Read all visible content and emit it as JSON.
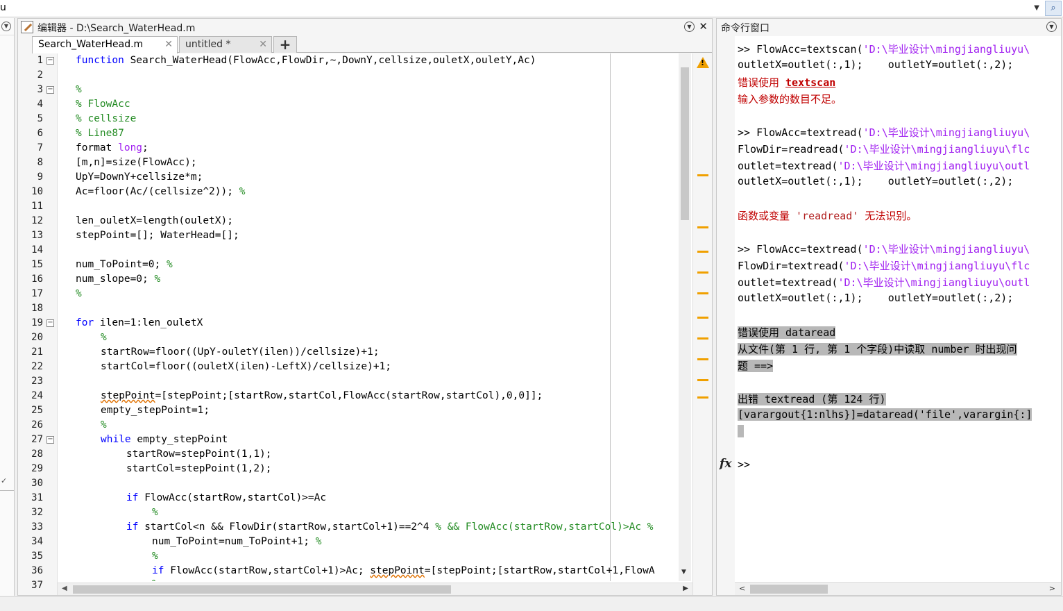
{
  "topbar": {
    "address_fragment": "u"
  },
  "editor": {
    "title_prefix": "编辑器 - ",
    "file_path": "D:\\Search_WaterHead.m",
    "tabs": [
      {
        "label": "Search_WaterHead.m"
      },
      {
        "label": "untitled *"
      }
    ],
    "add_tab_label": "+",
    "line_numbers": [
      "1",
      "2",
      "3",
      "4",
      "5",
      "6",
      "7",
      "8",
      "9",
      "10",
      "11",
      "12",
      "13",
      "14",
      "15",
      "16",
      "17",
      "18",
      "19",
      "20",
      "21",
      "22",
      "23",
      "24",
      "25",
      "26",
      "27",
      "28",
      "29",
      "30",
      "31",
      "32",
      "33",
      "34",
      "35",
      "36",
      "37"
    ],
    "fold_symbol": "−",
    "code": {
      "l1_kw": "function",
      "l1": " Search_WaterHead(FlowAcc,FlowDir,~,DownY,cellsize,ouletX,ouletY,Ac)",
      "l3": "%",
      "l4": "% FlowAcc",
      "l5": "% cellsize",
      "l6": "% Line87",
      "l7": "format ",
      "l7_kw": "long",
      "l7_end": ";",
      "l8": "[m,n]=size(FlowAcc);",
      "l9": "UpY=DownY+cellsize*m;",
      "l10": "Ac=floor(Ac/(cellsize^2)); ",
      "l10_c": "%",
      "l12": "len_ouletX=length(ouletX);",
      "l13": "stepPoint=[]; WaterHead=[];",
      "l15": "num_ToPoint=0; ",
      "l15_c": "%",
      "l16": "num_slope=0; ",
      "l16_c": "%",
      "l17": "%",
      "l19_kw": "for",
      "l19": " ilen=1:len_ouletX",
      "l20": "%",
      "l21": "startRow=floor((UpY-ouletY(ilen))/cellsize)+1;",
      "l22": "startCol=floor((ouletX(ilen)-LeftX)/cellsize)+1;",
      "l24_sq": "stepPoint",
      "l24": "=[stepPoint;[startRow,startCol,FlowAcc(startRow,startCol),0,0]];",
      "l25": "empty_stepPoint=1;",
      "l26": "%",
      "l27_kw": "while",
      "l27": " empty_stepPoint",
      "l28": "startRow=stepPoint(1,1);",
      "l29": "startCol=stepPoint(1,2);",
      "l31_kw": "if",
      "l31": " FlowAcc(startRow,startCol)>=Ac",
      "l32": "%",
      "l33_kw": "if",
      "l33": " startCol<n && FlowDir(startRow,startCol+1)==2^4 ",
      "l33_c": "% && FlowAcc(startRow,startCol)>Ac %",
      "l34": "num_ToPoint=num_ToPoint+1; ",
      "l34_c": "%",
      "l35": "%",
      "l36_kw": "if",
      "l36": " FlowAcc(startRow,startCol+1)>Ac; ",
      "l36_sq": "stepPoint",
      "l36_end": "=[stepPoint;[startRow,startCol+1,FlowA",
      "l37": "%"
    }
  },
  "command_window": {
    "title": "命令行窗口",
    "prompt": ">>",
    "lines": {
      "c1a": ">> FlowAcc=textscan(",
      "c1s": "'D:\\毕业设计\\mingjiangliuyu\\",
      "c2": "outletX=outlet(:,1);    outletY=outlet(:,2);",
      "c3a": "错误使用 ",
      "c3b": "textscan",
      "c4": "输入参数的数目不足。",
      "c6a": ">> FlowAcc=textread(",
      "c6s": "'D:\\毕业设计\\mingjiangliuyu\\",
      "c7a": "FlowDir=readread(",
      "c7s": "'D:\\毕业设计\\mingjiangliuyu\\flc",
      "c8a": "outlet=textread(",
      "c8s": "'D:\\毕业设计\\mingjiangliuyu\\outl",
      "c9": "outletX=outlet(:,1);    outletY=outlet(:,2);",
      "c11a": "函数或变量 ",
      "c11s": "'readread'",
      "c11b": " 无法识别。",
      "c13a": ">> FlowAcc=textread(",
      "c13s": "'D:\\毕业设计\\mingjiangliuyu\\",
      "c14a": "FlowDir=textread(",
      "c14s": "'D:\\毕业设计\\mingjiangliuyu\\flc",
      "c15a": "outlet=textread(",
      "c15s": "'D:\\毕业设计\\mingjiangliuyu\\outl",
      "c16": "outletX=outlet(:,1);    outletY=outlet(:,2);",
      "c18": "错误使用 dataread",
      "c19": "从文件(第 1 行, 第 1 个字段)中读取 number 时出现问",
      "c20": "题 ==>",
      "c22": "出错 textread (第 124 行)",
      "c23": "[varargout{1:nlhs}]=dataread('file',varargin{:]",
      "c24": " "
    }
  },
  "colors": {
    "keyword": "#0000ff",
    "comment": "#228b22",
    "string": "#a020f0",
    "error": "#c00000",
    "warning_marker": "#f0a000"
  },
  "icons": [
    "search-icon",
    "edit-pen-icon",
    "panel-menu-icon",
    "close-icon",
    "warning-icon",
    "fx-icon"
  ]
}
